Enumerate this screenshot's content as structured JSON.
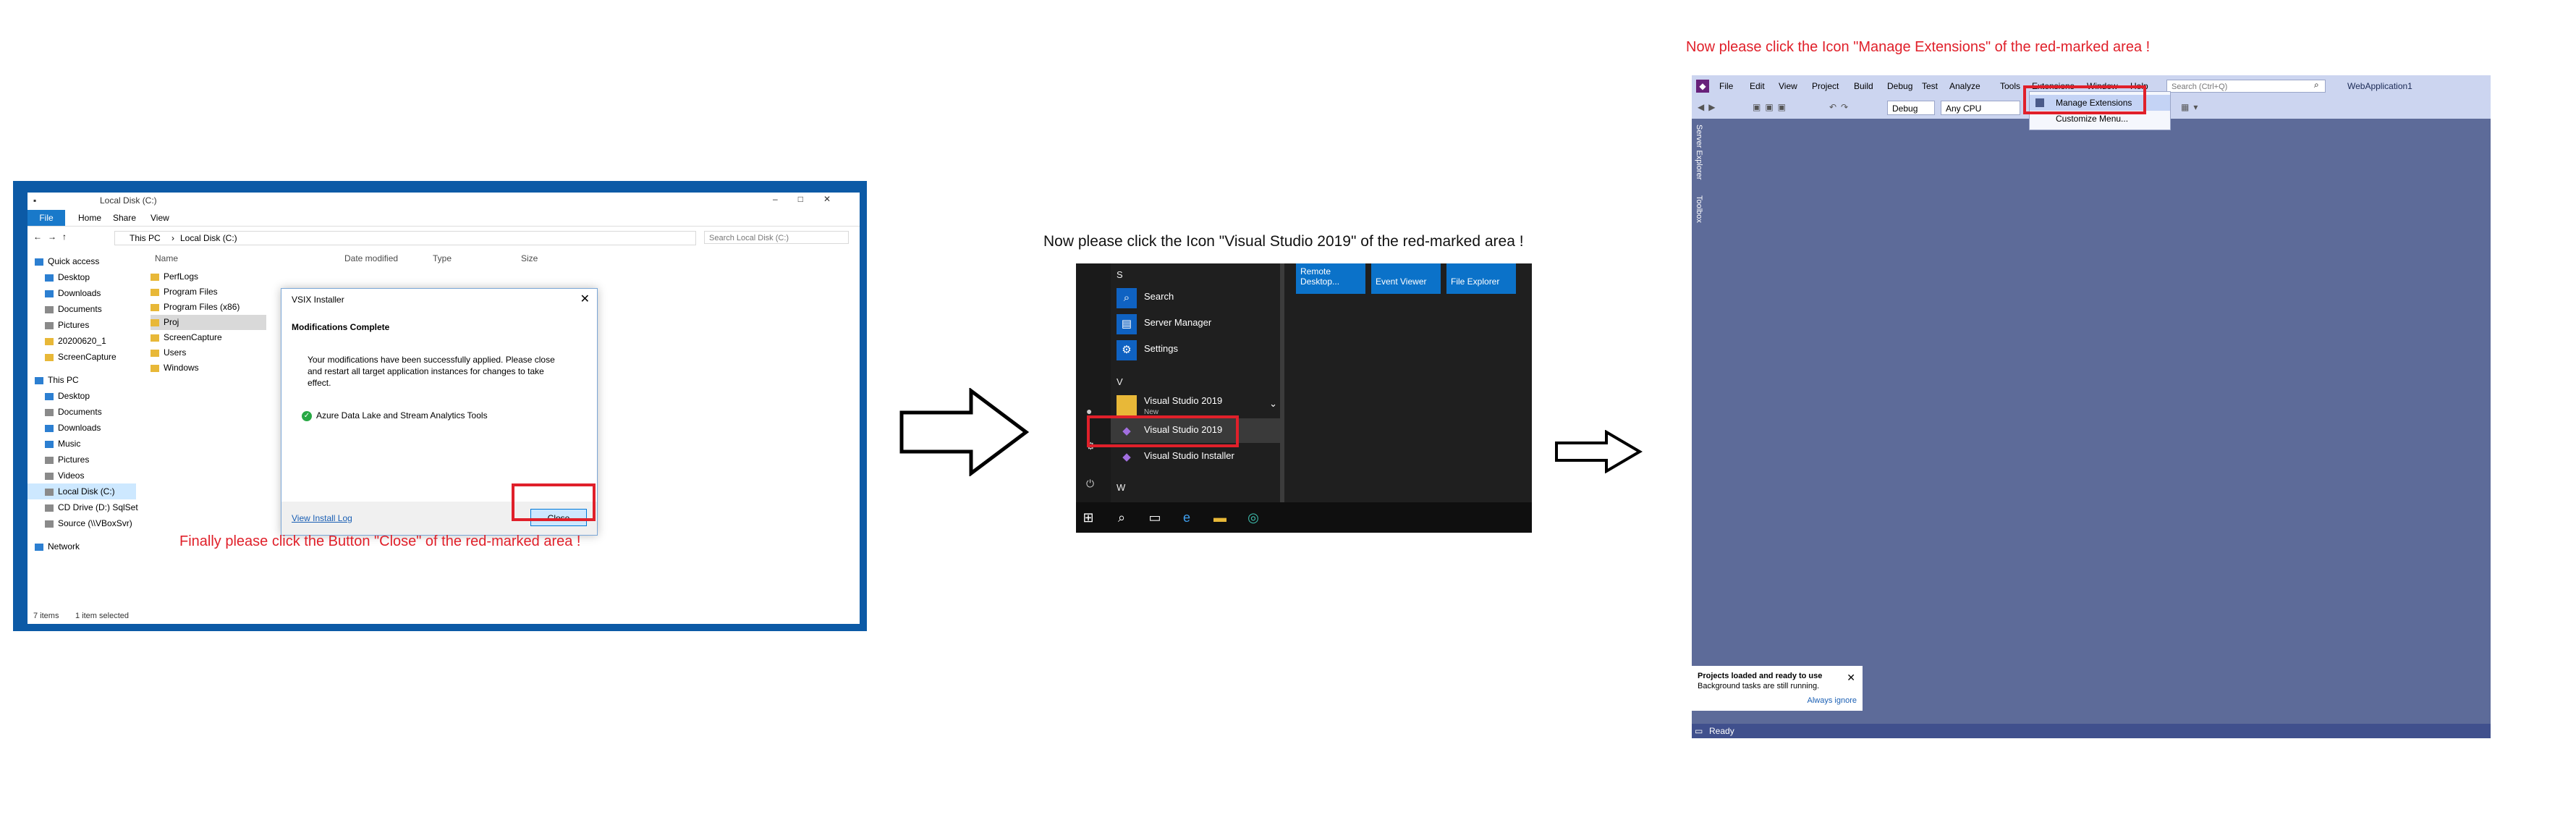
{
  "panel1": {
    "window_title": "Local Disk (C:)",
    "ribbon_tabs": [
      "File",
      "Home",
      "Share",
      "View"
    ],
    "address": [
      "This PC",
      "Local Disk (C:)"
    ],
    "search_placeholder": "Search Local Disk (C:)",
    "nav_items": [
      "Quick access",
      "Desktop",
      "Downloads",
      "Documents",
      "Pictures",
      "20200620_1",
      "ScreenCapture",
      "This PC",
      "Desktop",
      "Documents",
      "Downloads",
      "Music",
      "Pictures",
      "Videos",
      "Local Disk (C:)",
      "CD Drive (D:) SqlSet",
      "Source (\\\\VBoxSvr)",
      "Network"
    ],
    "columns": [
      "Name",
      "Date modified",
      "Type",
      "Size"
    ],
    "files": [
      "PerfLogs",
      "Program Files",
      "Program Files (x86)",
      "Proj",
      "ScreenCapture",
      "Users",
      "Windows"
    ],
    "status": [
      "7 items",
      "1 item selected"
    ],
    "dialog": {
      "title": "VSIX Installer",
      "heading": "Modifications Complete",
      "message": "Your modifications have been successfully applied. Please close and restart all target application instances for changes to take effect.",
      "component": "Azure Data Lake and Stream Analytics Tools",
      "link": "View Install Log",
      "button": "Close"
    },
    "instruction": "Finally please click the Button \"Close\" of the red-marked area !"
  },
  "panel2": {
    "instruction": "Now please click the Icon \"Visual Studio 2019\" of the red-marked area !",
    "letters": [
      "S",
      "V",
      "W"
    ],
    "apps": [
      {
        "label": "Search",
        "sub": ""
      },
      {
        "label": "Server Manager",
        "sub": ""
      },
      {
        "label": "Settings",
        "sub": ""
      },
      {
        "label": "Visual Studio 2019",
        "sub": "New"
      },
      {
        "label": "Visual Studio 2019",
        "sub": ""
      },
      {
        "label": "Visual Studio Installer",
        "sub": ""
      }
    ],
    "tiles": [
      "Remote Desktop...",
      "Event Viewer",
      "File Explorer"
    ]
  },
  "panel3": {
    "instruction": "Now please click the Icon \"Manage Extensions\" of the red-marked area !",
    "menus": [
      "File",
      "Edit",
      "View",
      "Project",
      "Build",
      "Debug",
      "Test",
      "Analyze",
      "Tools",
      "Extensions",
      "Window",
      "Help"
    ],
    "search_placeholder": "Search (Ctrl+Q)",
    "solution": "WebApplication1",
    "config": "Debug",
    "platform": "Any CPU",
    "dropdown": [
      "Manage Extensions",
      "Customize Menu..."
    ],
    "side_tabs": [
      "Server Explorer",
      "Toolbox"
    ],
    "notification": {
      "title": "Projects loaded and ready to use",
      "message": "Background tasks are still running.",
      "link": "Always ignore"
    },
    "status": "Ready"
  }
}
